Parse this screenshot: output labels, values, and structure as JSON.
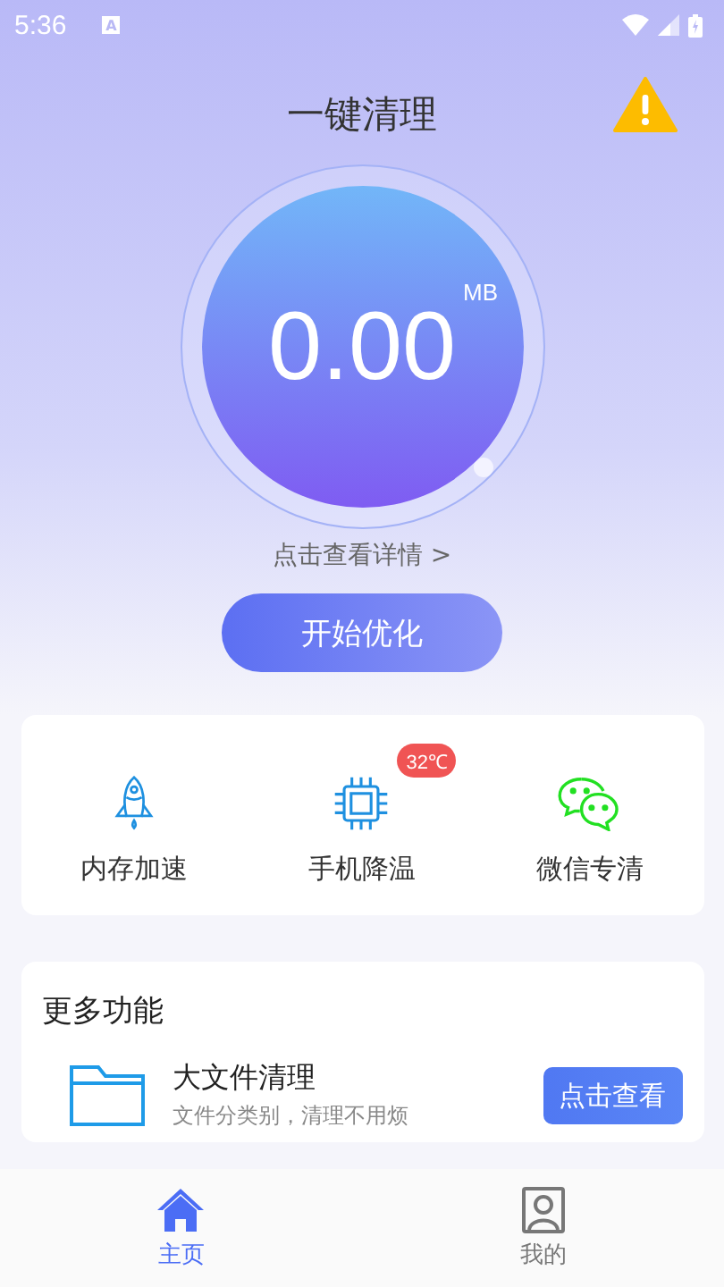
{
  "status_bar": {
    "time": "5:36",
    "notification": "A"
  },
  "header": {
    "title": "一键清理"
  },
  "gauge": {
    "value": "0.00",
    "unit": "MB",
    "details_link": "点击查看详情 >"
  },
  "primary_button": "开始优化",
  "quick_tools": [
    {
      "kind": "rocket",
      "label": "内存加速"
    },
    {
      "kind": "chip",
      "label": "手机降温",
      "badge": "32℃"
    },
    {
      "kind": "chat",
      "label": "微信专清"
    }
  ],
  "more": {
    "title": "更多功能",
    "items": [
      {
        "kind": "folder",
        "title": "大文件清理",
        "subtitle": "文件分类别，清理不用烦",
        "action": "点击查看"
      }
    ]
  },
  "bottom_nav": [
    {
      "kind": "home",
      "label": "主页",
      "selected": true
    },
    {
      "kind": "person",
      "label": "我的",
      "selected": false
    }
  ]
}
